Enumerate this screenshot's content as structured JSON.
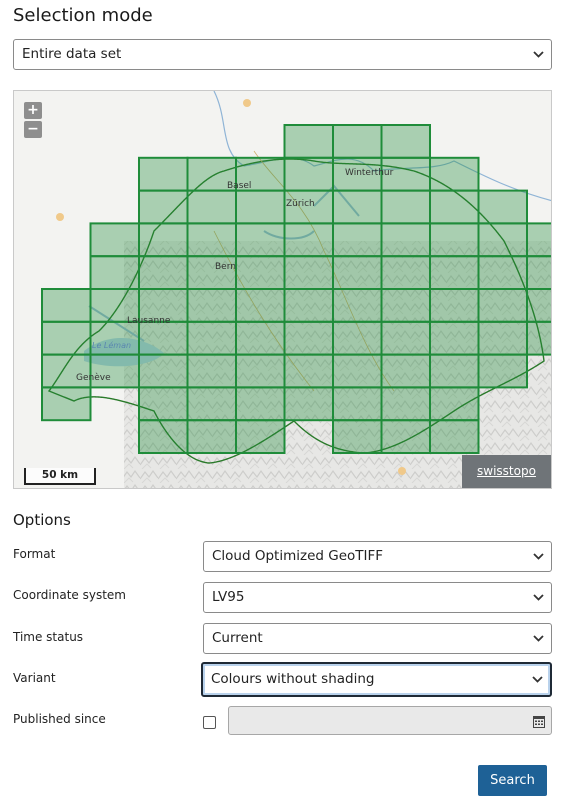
{
  "page_title": "Selection mode",
  "selection_mode": {
    "value": "Entire data set"
  },
  "map": {
    "zoom_in": "+",
    "zoom_out": "−",
    "scale_label": "50 km",
    "attribution": "swisstopo",
    "places": [
      "Basel",
      "Zürich",
      "Winterthur",
      "Bern",
      "Lausanne",
      "Genève",
      "Le Léman"
    ],
    "tile_color": "#1f8c3a"
  },
  "options": {
    "heading": "Options",
    "format": {
      "label": "Format",
      "value": "Cloud Optimized GeoTIFF"
    },
    "coordinate_system": {
      "label": "Coordinate system",
      "value": "LV95"
    },
    "time_status": {
      "label": "Time status",
      "value": "Current"
    },
    "variant": {
      "label": "Variant",
      "value": "Colours without shading"
    },
    "published_since": {
      "label": "Published since",
      "value": ""
    }
  },
  "search_button": "Search"
}
